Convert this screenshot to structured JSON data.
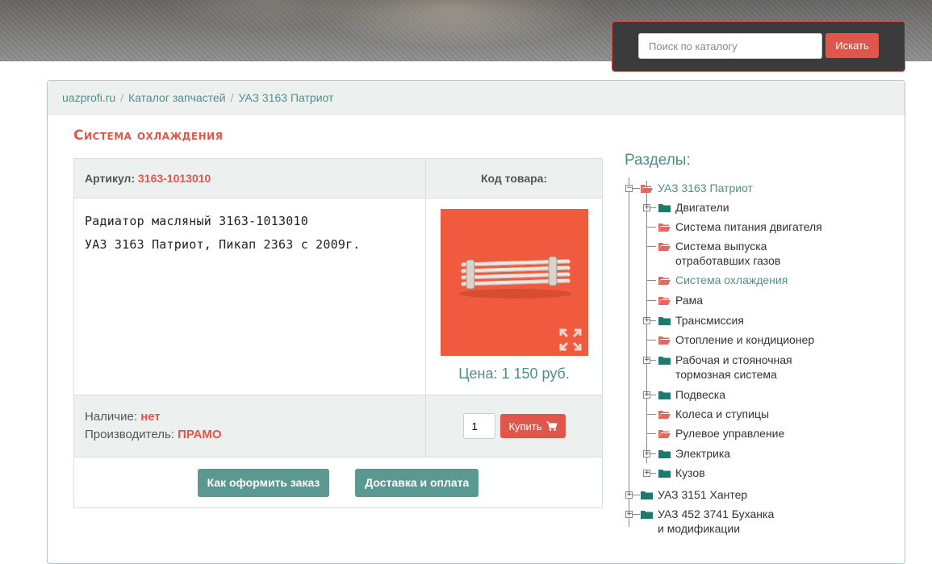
{
  "search": {
    "placeholder": "Поиск по каталогу",
    "button_label": "Искать"
  },
  "breadcrumb": {
    "items": [
      "uazprofi.ru",
      "Каталог запчастей",
      "УАЗ 3163 Патриот"
    ],
    "separator": "/"
  },
  "page_title": "Система охлаждения",
  "product": {
    "article_label": "Артикул:",
    "article_value": "3163-1013010",
    "code_label": "Код товара:",
    "name_line1": "Радиатор масляный 3163-1013010",
    "name_line2": "УАЗ 3163 Патриот, Пикап 2363 с 2009г.",
    "price": "Цена: 1 150 руб.",
    "stock_label": "Наличие:",
    "stock_value": "нет",
    "maker_label": "Производитель:",
    "maker_value": "ПРАМО",
    "quantity": "1",
    "buy_label": "Купить",
    "image_color": "#f05a3e"
  },
  "actions": {
    "how_to_order": "Как оформить заказ",
    "delivery": "Доставка и оплата"
  },
  "sections": {
    "title": "Разделы:",
    "tree": [
      {
        "label": "УАЗ 3163 Патриот",
        "level": 0,
        "toggle": "minus",
        "folder": "open-red",
        "active": true
      },
      {
        "label": "Двигатели",
        "level": 1,
        "toggle": "plus",
        "folder": "teal"
      },
      {
        "label": "Система питания двигателя",
        "level": 1,
        "folder": "open-red"
      },
      {
        "label": "Система выпуска отработавших газов",
        "level": 1,
        "folder": "open-red"
      },
      {
        "label": "Система охлаждения",
        "level": 1,
        "folder": "open-red",
        "active": true
      },
      {
        "label": "Рама",
        "level": 1,
        "folder": "open-red"
      },
      {
        "label": "Трансмиссия",
        "level": 1,
        "toggle": "plus",
        "folder": "teal"
      },
      {
        "label": "Отопление и кондиционер",
        "level": 1,
        "folder": "open-red"
      },
      {
        "label": "Рабочая и стояночная тормозная система",
        "level": 1,
        "toggle": "plus",
        "folder": "teal"
      },
      {
        "label": "Подвеска",
        "level": 1,
        "toggle": "plus",
        "folder": "teal"
      },
      {
        "label": "Колеса и ступицы",
        "level": 1,
        "folder": "open-red"
      },
      {
        "label": "Рулевое управление",
        "level": 1,
        "folder": "open-red"
      },
      {
        "label": "Электрика",
        "level": 1,
        "toggle": "plus",
        "folder": "teal"
      },
      {
        "label": "Кузов",
        "level": 1,
        "toggle": "plus",
        "folder": "teal"
      },
      {
        "label": "УАЗ 3151 Хантер",
        "level": 0,
        "toggle": "plus",
        "folder": "teal"
      },
      {
        "label": "УАЗ 452 3741 Буханка и модификации",
        "level": 0,
        "toggle": "plus",
        "folder": "teal"
      }
    ]
  },
  "colors": {
    "accent_red": "#e0564a",
    "teal": "#4f8f89",
    "button_teal": "#5a9892"
  }
}
